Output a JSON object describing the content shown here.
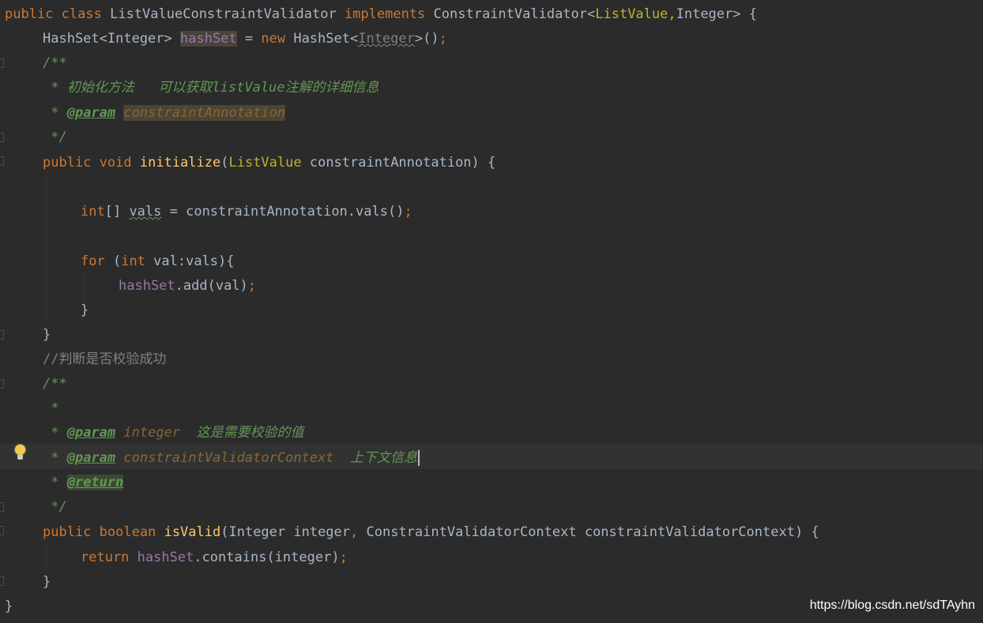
{
  "code": {
    "l1": {
      "kw_public": "public",
      "kw_class": "class",
      "class_name": "ListValueConstraintValidator",
      "kw_implements": "implements",
      "iface": "ConstraintValidator<",
      "generic1": "ListValue,",
      "generic2": "Integer> {"
    },
    "l2": {
      "type_a": "HashSet<Integer> ",
      "field": "hashSet",
      "eq": " = ",
      "kw_new": "new",
      "type_b": " HashSet<",
      "type_arg": "Integer",
      "tail": ">()",
      "semi": ";"
    },
    "l3": {
      "text": "/**"
    },
    "l4": {
      "text": " * 初始化方法   可以获取listValue注解的详细信息"
    },
    "l5": {
      "star": " * ",
      "tag": "@param",
      "param": "constraintAnnotation"
    },
    "l6": {
      "text": " */"
    },
    "l7": {
      "kw_public": "public",
      "kw_void": "void",
      "method": "initialize",
      "open": "(",
      "param_type": "ListValue",
      "param_rest": " constraintAnnotation) {"
    },
    "l9": {
      "kw_int": "int",
      "arr": "[] ",
      "var": "vals",
      "rest": " = constraintAnnotation.vals()",
      "semi": ";"
    },
    "l11": {
      "kw_for": "for",
      "open": " (",
      "kw_int": "int",
      "rest": " val:vals){"
    },
    "l12": {
      "field": "hashSet",
      "rest": ".add(val)",
      "semi": ";"
    },
    "l13": {
      "text": "}"
    },
    "l14": {
      "text": "}"
    },
    "l15": {
      "text": "//判断是否校验成功"
    },
    "l16": {
      "text": "/**"
    },
    "l17": {
      "text": " *"
    },
    "l18": {
      "star": " * ",
      "tag": "@param",
      "param": "integer",
      "desc": "  这是需要校验的值"
    },
    "l19": {
      "star": " * ",
      "tag": "@param",
      "param": "constraintValidatorContext",
      "desc": "  上下文信息"
    },
    "l20": {
      "star": " * ",
      "tag": "@return"
    },
    "l21": {
      "text": " */"
    },
    "l22": {
      "kw_public": "public",
      "kw_boolean": "boolean",
      "method": "isValid",
      "open": "(",
      "p1": "Integer integer",
      "comma": ", ",
      "p2": "ConstraintValidatorContext constraintValidatorContext) {"
    },
    "l23": {
      "kw_return": "return",
      "field": "hashSet",
      "rest": ".contains(integer)",
      "semi": ";"
    },
    "l24": {
      "text": "}"
    },
    "l25": {
      "text": "}"
    }
  },
  "watermark": "https://blog.csdn.net/sdTAyhn",
  "colors": {
    "background": "#2b2b2b",
    "keyword": "#cc7832",
    "annotation_type": "#bbb529",
    "method": "#ffc66d",
    "field": "#9876aa",
    "doc": "#629755",
    "comment": "#808080",
    "text": "#a9b7c6"
  }
}
